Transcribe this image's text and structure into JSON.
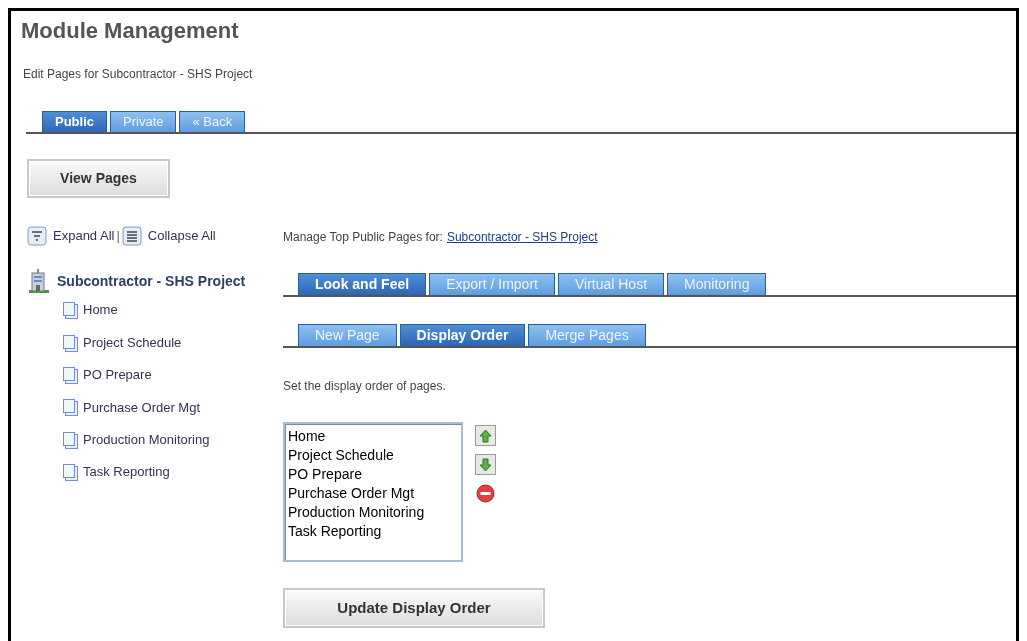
{
  "title": "Module Management",
  "subtitle": "Edit Pages for Subcontractor - SHS Project",
  "top_tabs": [
    {
      "label": "Public",
      "selected": true
    },
    {
      "label": "Private",
      "selected": false
    },
    {
      "label": "« Back",
      "selected": false
    }
  ],
  "view_pages_button": "View Pages",
  "tree_controls": {
    "expand": "Expand All",
    "separator": "|",
    "collapse": "Collapse All"
  },
  "tree": {
    "label": "Subcontractor - SHS Project",
    "children": [
      {
        "label": "Home"
      },
      {
        "label": "Project Schedule"
      },
      {
        "label": "PO Prepare"
      },
      {
        "label": "Purchase Order Mgt"
      },
      {
        "label": "Production Monitoring"
      },
      {
        "label": "Task Reporting"
      }
    ]
  },
  "manage_text": "Manage Top Public Pages for:",
  "manage_link": "Subcontractor - SHS Project",
  "section_tabs": [
    {
      "label": "Look and Feel",
      "selected": true
    },
    {
      "label": "Export / Import",
      "selected": false
    },
    {
      "label": "Virtual Host",
      "selected": false
    },
    {
      "label": "Monitoring",
      "selected": false
    }
  ],
  "sub_tabs": [
    {
      "label": "New Page",
      "selected": false
    },
    {
      "label": "Display Order",
      "selected": true
    },
    {
      "label": "Merge Pages",
      "selected": false
    }
  ],
  "instruction": "Set the display order of pages.",
  "order_list": [
    "Home",
    "Project Schedule",
    "PO Prepare",
    "Purchase Order Mgt",
    "Production Monitoring",
    "Task Reporting"
  ],
  "update_button": "Update Display Order"
}
